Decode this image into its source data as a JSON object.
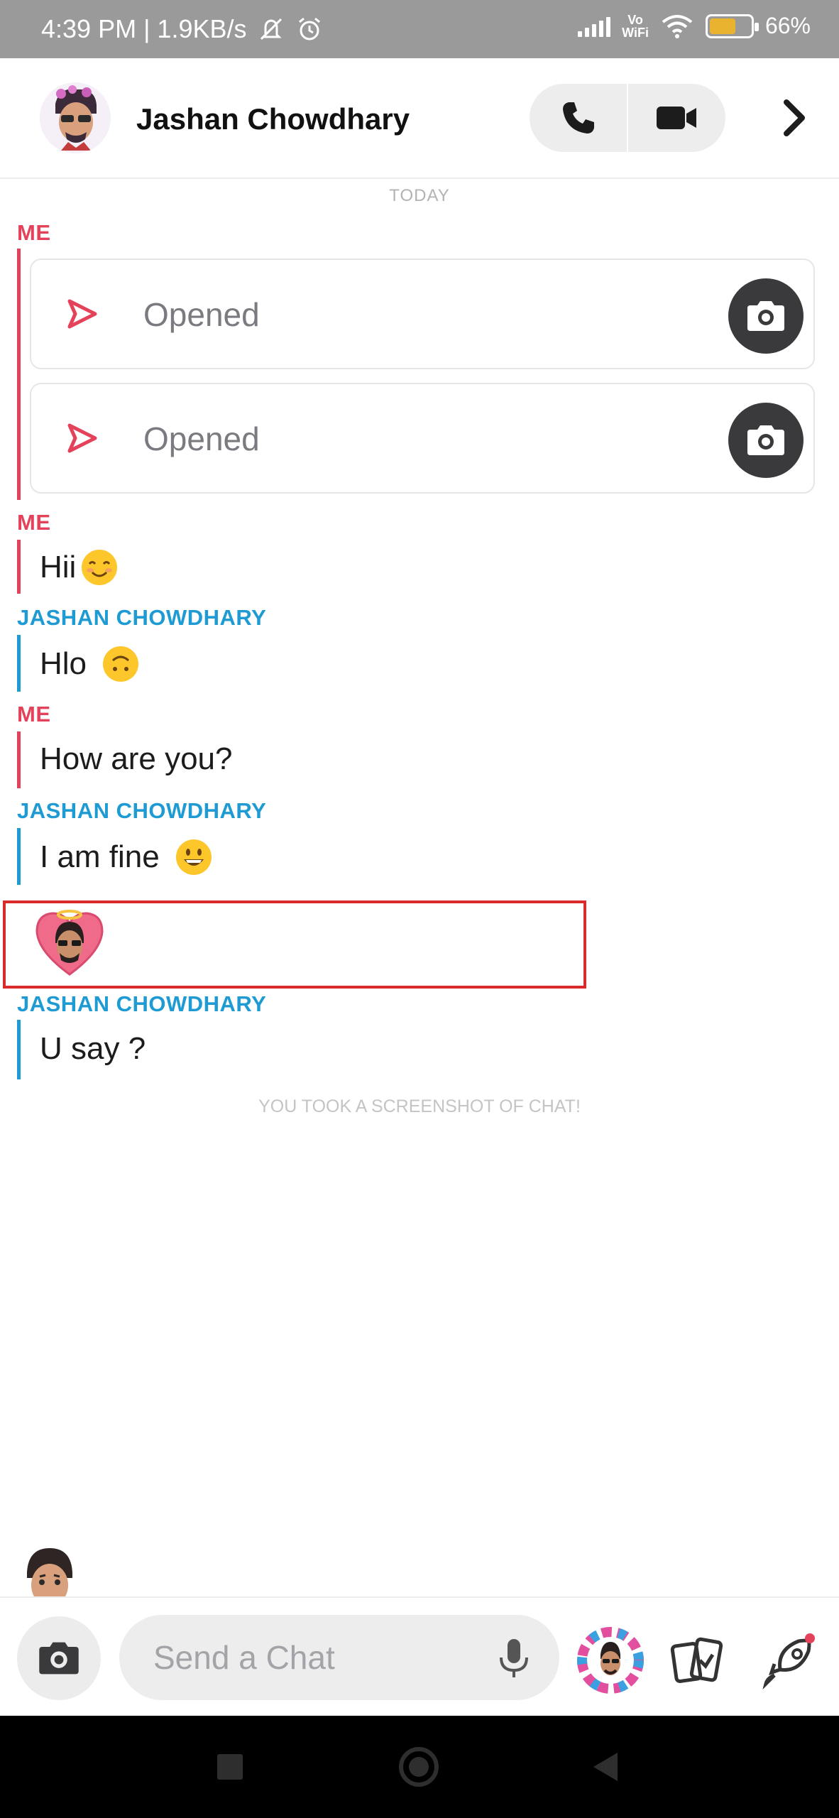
{
  "status_bar": {
    "time_speed": "4:39 PM | 1.9KB/s",
    "vowifi": "Vo WiFi",
    "battery_percent": "66%",
    "battery_level": 0.66
  },
  "header": {
    "contact_name": "Jashan Chowdhary"
  },
  "chat": {
    "date_separator": "TODAY",
    "blocks": [
      {
        "sender": "ME",
        "snaps": [
          {
            "label": "Opened"
          },
          {
            "label": "Opened"
          }
        ]
      },
      {
        "sender": "ME",
        "text": "Hii",
        "emoji": "smiling-face-emoji"
      },
      {
        "sender": "JASHAN CHOWDHARY",
        "text": "Hlo",
        "emoji": "upside-down-face-emoji"
      },
      {
        "sender": "ME",
        "text": "How are you?"
      },
      {
        "sender": "JASHAN CHOWDHARY",
        "text": "I am fine",
        "emoji": "grinning-face-emoji"
      },
      {
        "sender": "JASHAN CHOWDHARY",
        "text": "U say ?"
      }
    ],
    "system_notice": "YOU TOOK A SCREENSHOT OF CHAT!"
  },
  "composer": {
    "placeholder": "Send a Chat"
  },
  "colors": {
    "me": "#e4415a",
    "them": "#1f9bd4",
    "highlight": "#d92b2b"
  }
}
